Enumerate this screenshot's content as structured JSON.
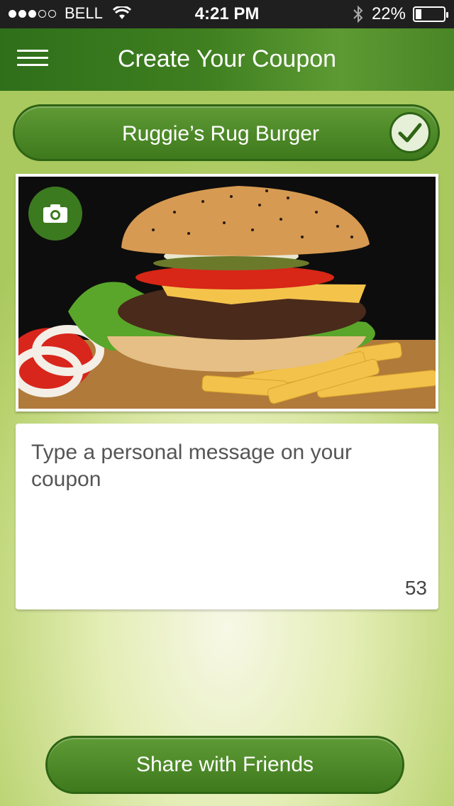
{
  "status_bar": {
    "signal_bars_filled": 3,
    "signal_bars_total": 5,
    "carrier": "BELL",
    "time": "4:21 PM",
    "battery_percent": "22%",
    "battery_level": 0.22
  },
  "nav": {
    "title": "Create Your Coupon",
    "menu_icon": "hamburger-menu-icon"
  },
  "restaurant": {
    "name": "Ruggie’s Rug Burger",
    "selected": true,
    "icon": "checkmark-icon"
  },
  "photo": {
    "camera_icon": "camera-icon"
  },
  "message": {
    "placeholder": "Type a personal message on your coupon",
    "value": "",
    "char_remaining": "53"
  },
  "share": {
    "label": "Share with Friends"
  },
  "colors": {
    "brand_green": "#3e7a1d",
    "dark_green": "#2e6414",
    "background": "#c8de86"
  }
}
